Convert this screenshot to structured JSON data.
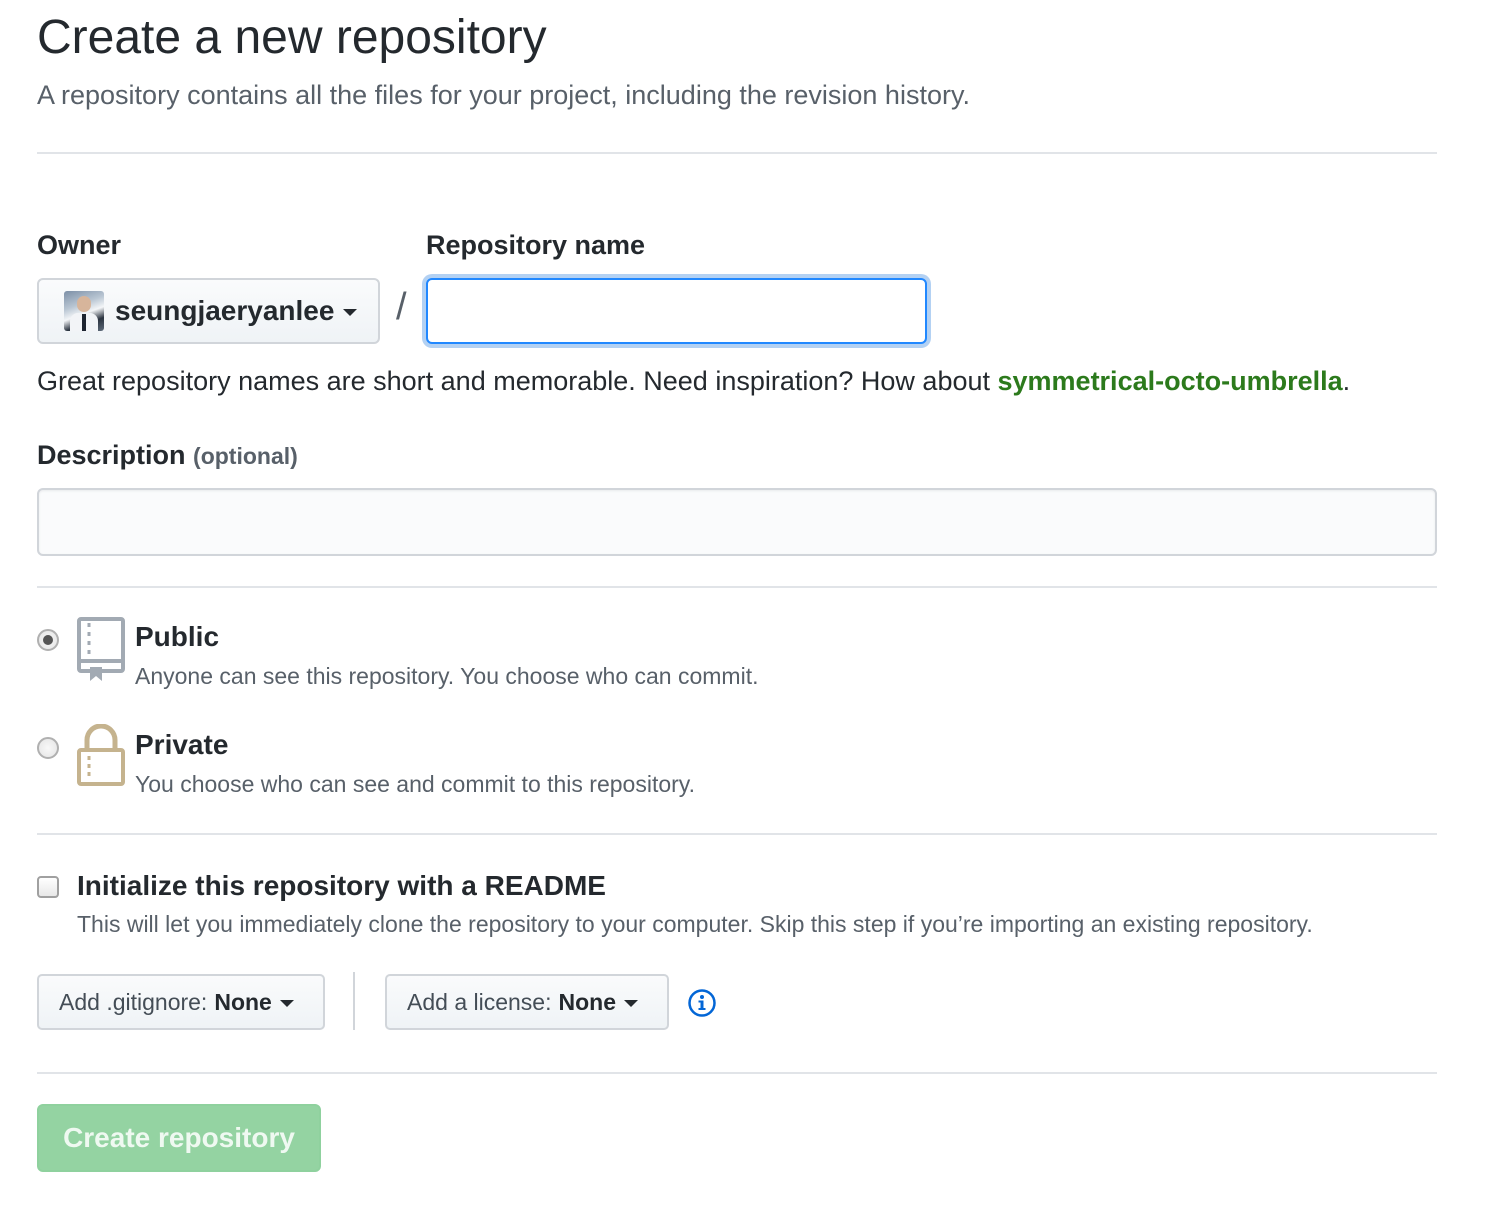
{
  "header": {
    "title": "Create a new repository",
    "subtitle": "A repository contains all the files for your project, including the revision history."
  },
  "owner": {
    "label": "Owner",
    "username": "seungjaeryanlee"
  },
  "separator": "/",
  "repository_name": {
    "label": "Repository name",
    "value": "",
    "placeholder": ""
  },
  "name_hint": {
    "text": "Great repository names are short and memorable. Need inspiration? How about ",
    "suggestion": "symmetrical-octo-umbrella",
    "end": "."
  },
  "description": {
    "label": "Description",
    "optional_tag": "(optional)",
    "value": "",
    "placeholder": ""
  },
  "visibility": {
    "selected": "public",
    "options": [
      {
        "id": "public",
        "title": "Public",
        "description": "Anyone can see this repository. You choose who can commit.",
        "icon": "repo-book-icon"
      },
      {
        "id": "private",
        "title": "Private",
        "description": "You choose who can see and commit to this repository.",
        "icon": "lock-icon"
      }
    ]
  },
  "readme": {
    "checked": false,
    "title": "Initialize this repository with a README",
    "description": "This will let you immediately clone the repository to your computer. Skip this step if you’re importing an existing repository."
  },
  "gitignore": {
    "prefix": "Add .gitignore:",
    "value": "None"
  },
  "license": {
    "prefix": "Add a license:",
    "value": "None"
  },
  "submit": {
    "label": "Create repository",
    "disabled": true
  },
  "colors": {
    "link_focus": "#2188ff",
    "suggestion": "#2c7a1c",
    "create_button_bg": "#94d3a2",
    "info_icon": "#0366d6"
  }
}
